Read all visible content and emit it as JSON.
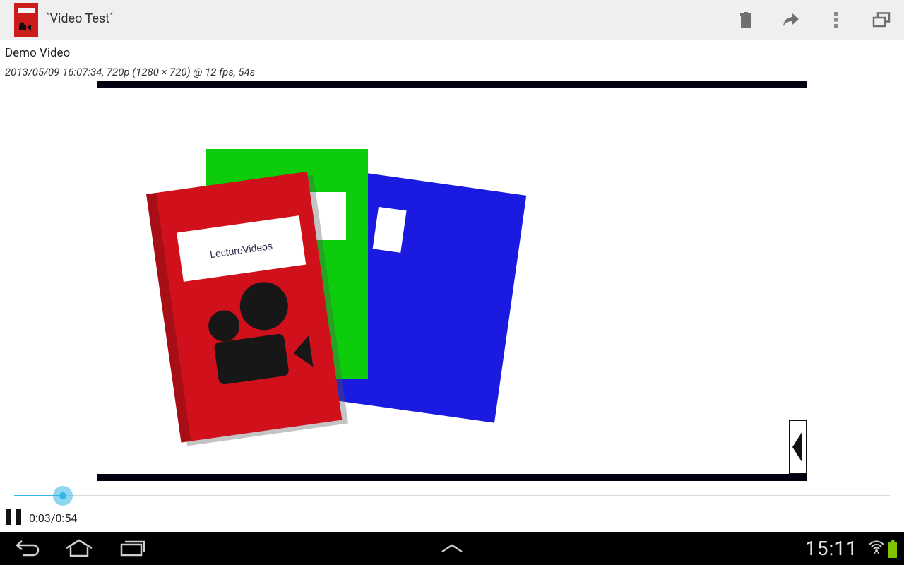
{
  "app": {
    "title": "`Video Test´",
    "icon": "video-notebook-icon"
  },
  "toolbar": {
    "actions": [
      "trash-icon",
      "share-icon",
      "overflow-menu-icon",
      "window-restore-icon"
    ]
  },
  "video": {
    "title": "Demo Video",
    "meta": "2013/05/09 16:07:34, 720p (1280 × 720) @ 12 fps, 54s",
    "frame_text": "LectureVideos"
  },
  "playback": {
    "state": "playing",
    "current_time": "0:03",
    "duration": "0:54",
    "time_display": "0:03/0:54",
    "progress_fraction": 0.056,
    "accent_color": "#33b5e5"
  },
  "system_bar": {
    "buttons": [
      "back-icon",
      "home-icon",
      "recent-apps-icon",
      "up-chevron-icon"
    ],
    "clock": "15:11",
    "status_icons": [
      "wifi-icon",
      "battery-icon"
    ],
    "battery_color": "#7fc400"
  }
}
